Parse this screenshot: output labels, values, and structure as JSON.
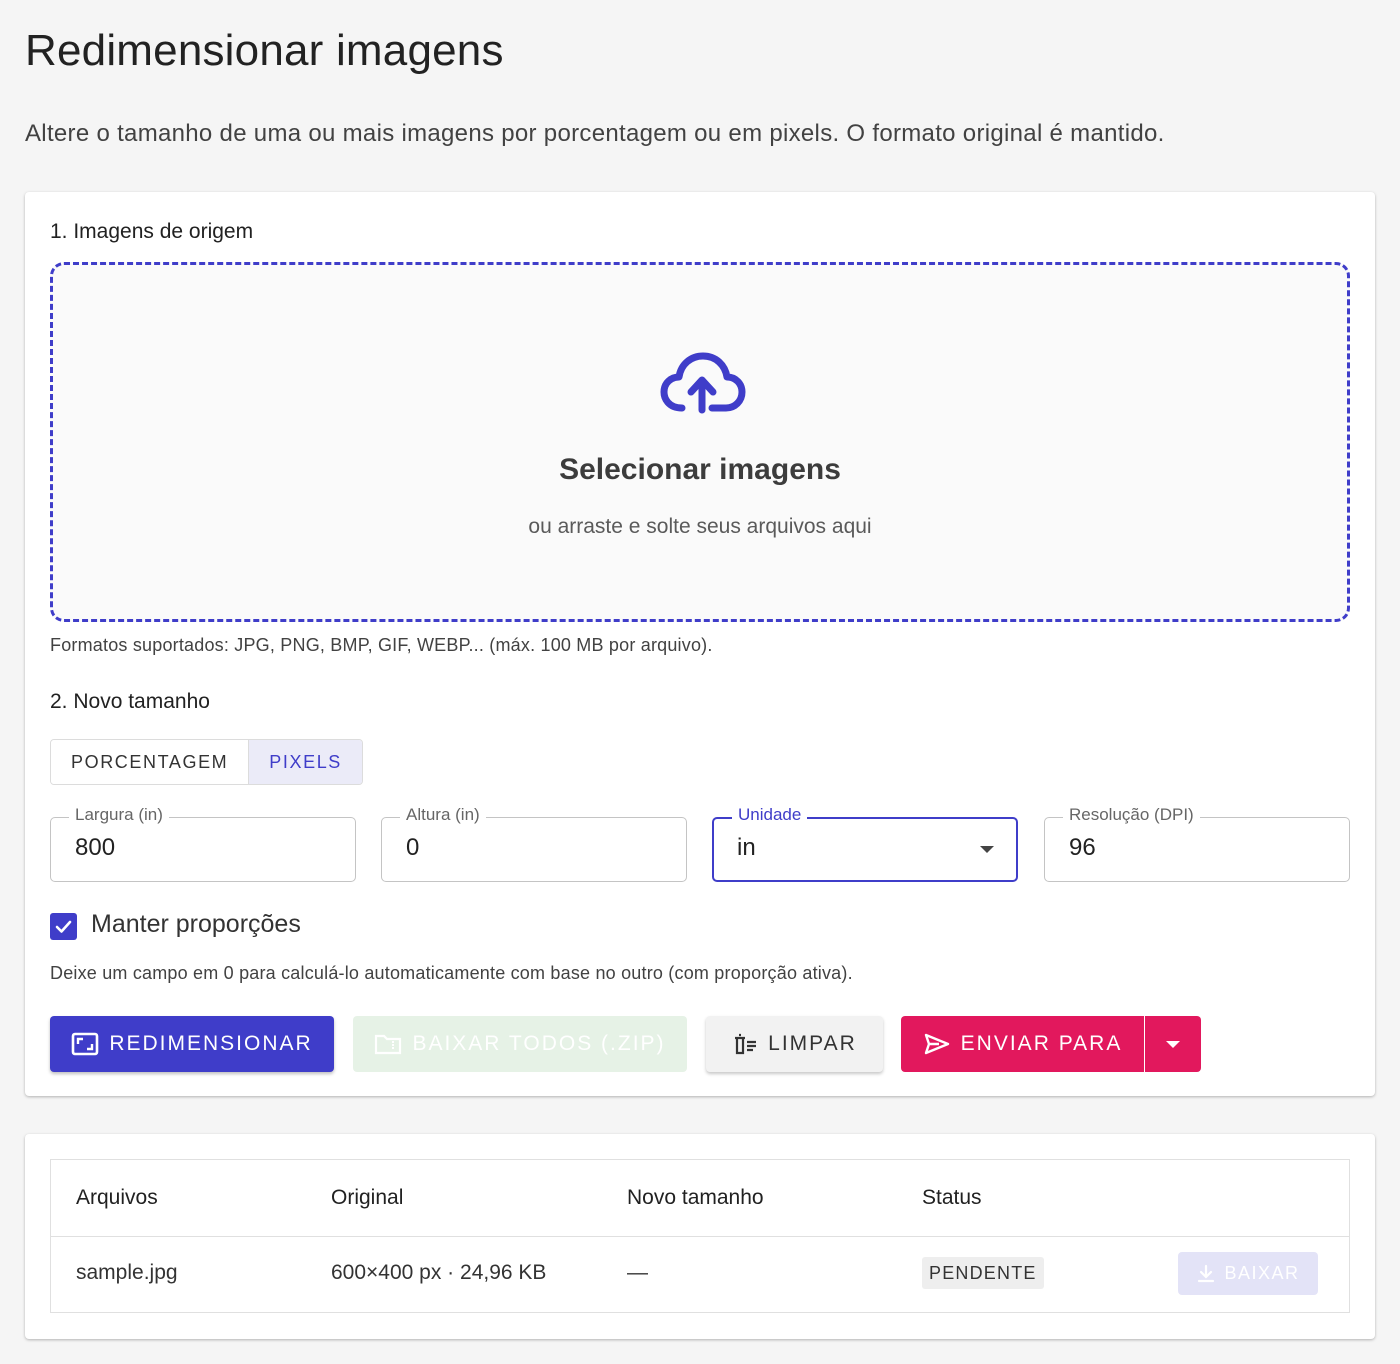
{
  "header": {
    "title": "Redimensionar imagens",
    "subtitle": "Altere o tamanho de uma ou mais imagens por porcentagem ou em pixels. O formato original é mantido."
  },
  "source": {
    "section_label": "1. Imagens de origem",
    "dropzone_title": "Selecionar imagens",
    "dropzone_hint": "ou arraste e solte seus arquivos aqui",
    "dropzone_icon": "cloud-upload-icon",
    "formats_note": "Formatos suportados: JPG, PNG, BMP, GIF, WEBP... (máx. 100 MB por arquivo)."
  },
  "size": {
    "section_label": "2. Novo tamanho",
    "modes": [
      {
        "label": "PORCENTAGEM",
        "active": false
      },
      {
        "label": "PIXELS",
        "active": true
      }
    ],
    "fields": {
      "width": {
        "label": "Largura (in)",
        "value": "800"
      },
      "height": {
        "label": "Altura (in)",
        "value": "0"
      },
      "unit": {
        "label": "Unidade",
        "value": "in"
      },
      "dpi": {
        "label": "Resolução (DPI)",
        "value": "96"
      }
    },
    "keep_aspect": {
      "label": "Manter proporções",
      "checked": true
    },
    "helper": "Deixe um campo em 0 para calculá-lo automaticamente com base no outro (com proporção ativa)."
  },
  "actions": {
    "resize": "REDIMENSIONAR",
    "download_all": "BAIXAR TODOS (.ZIP)",
    "clear": "LIMPAR",
    "send_to": "ENVIAR PARA"
  },
  "table": {
    "headers": [
      "Arquivos",
      "Original",
      "Novo tamanho",
      "Status"
    ],
    "rows": [
      {
        "file": "sample.jpg",
        "original": "600×400 px · 24,96 KB",
        "new_size": "—",
        "status": "PENDENTE",
        "action": "BAIXAR"
      }
    ]
  },
  "colors": {
    "primary": "#3f3dc9",
    "accent": "#e2185d",
    "disabled_green": "#e6f2e6",
    "background": "#f5f5f5"
  }
}
